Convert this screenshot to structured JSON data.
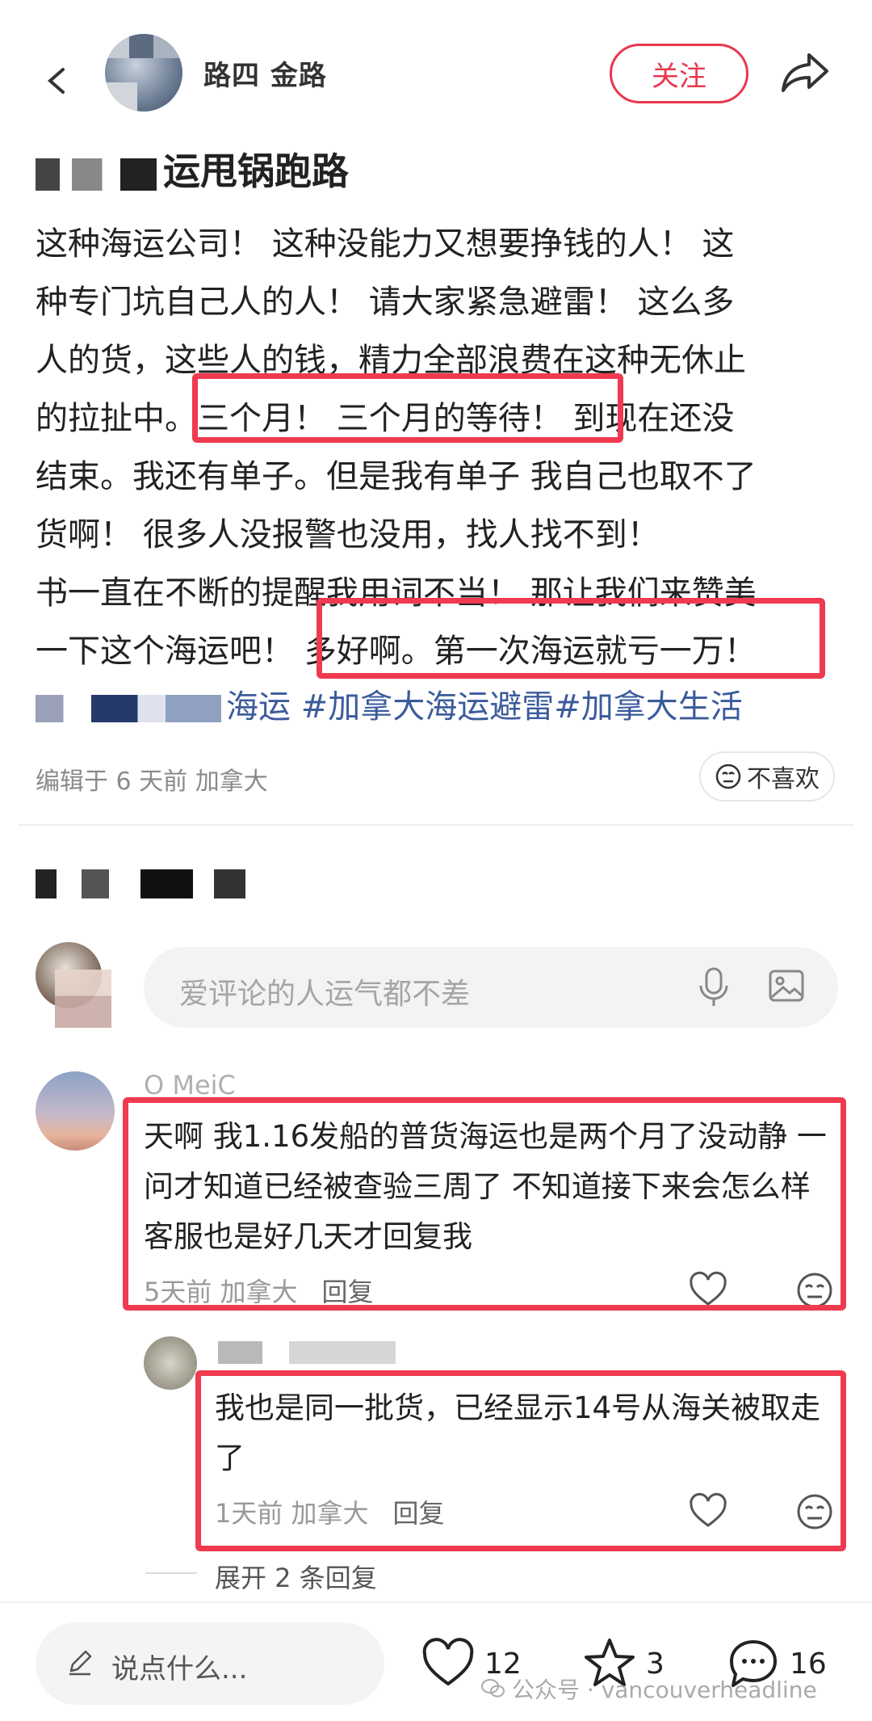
{
  "header": {
    "author_name": "路四 金路",
    "follow_label": "关注"
  },
  "post": {
    "title": "运甩锅跑路",
    "body_lines": [
      "这种海运公司！ 这种没能力又想要挣钱的人！ 这",
      "种专门坑自己人的人！ 请大家紧急避雷！ 这么多",
      "人的货，这些人的钱，精力全部浪费在这种无休止",
      "的拉扯中。三个月！ 三个月的等待！ 到现在还没",
      "结束。我还有单子。但是我有单子 我自己也取不了",
      "货啊！ 很多人没报警也没用，找人找不到！",
      "书一直在不断的提醒我用词不当！ 那让我们来赞美",
      "一下这个海运吧！ 多好啊。第一次海运就亏一万！"
    ],
    "tags": "海运 #加拿大海运避雷#加拿大生活",
    "edit_meta": "编辑于 6 天前 加拿大",
    "dislike_label": "不喜欢"
  },
  "comments_section": {
    "count_label": "共 16 条评论",
    "input_placeholder": "爱评论的人运气都不差"
  },
  "comment1": {
    "name": "O MeiC",
    "text": "天啊 我1.16发船的普货海运也是两个月了没动静 一问才知道已经被查验三周了 不知道接下来会怎么样 客服也是好几天才回复我",
    "time_location": "5天前 加拿大",
    "reply_label": "回复"
  },
  "reply1": {
    "text": "我也是同一批货，已经显示14号从海关被取走了",
    "time_location": "1天前 加拿大",
    "reply_label": "回复",
    "expand_label": "展开 2 条回复"
  },
  "bottom_bar": {
    "say_placeholder": "说点什么...",
    "likes": "12",
    "stars": "3",
    "comments": "16"
  },
  "watermark": "公众号 · vancouverheadline",
  "colors": {
    "accent_red": "#ef3a4f",
    "tag_blue": "#3b5b9c"
  }
}
